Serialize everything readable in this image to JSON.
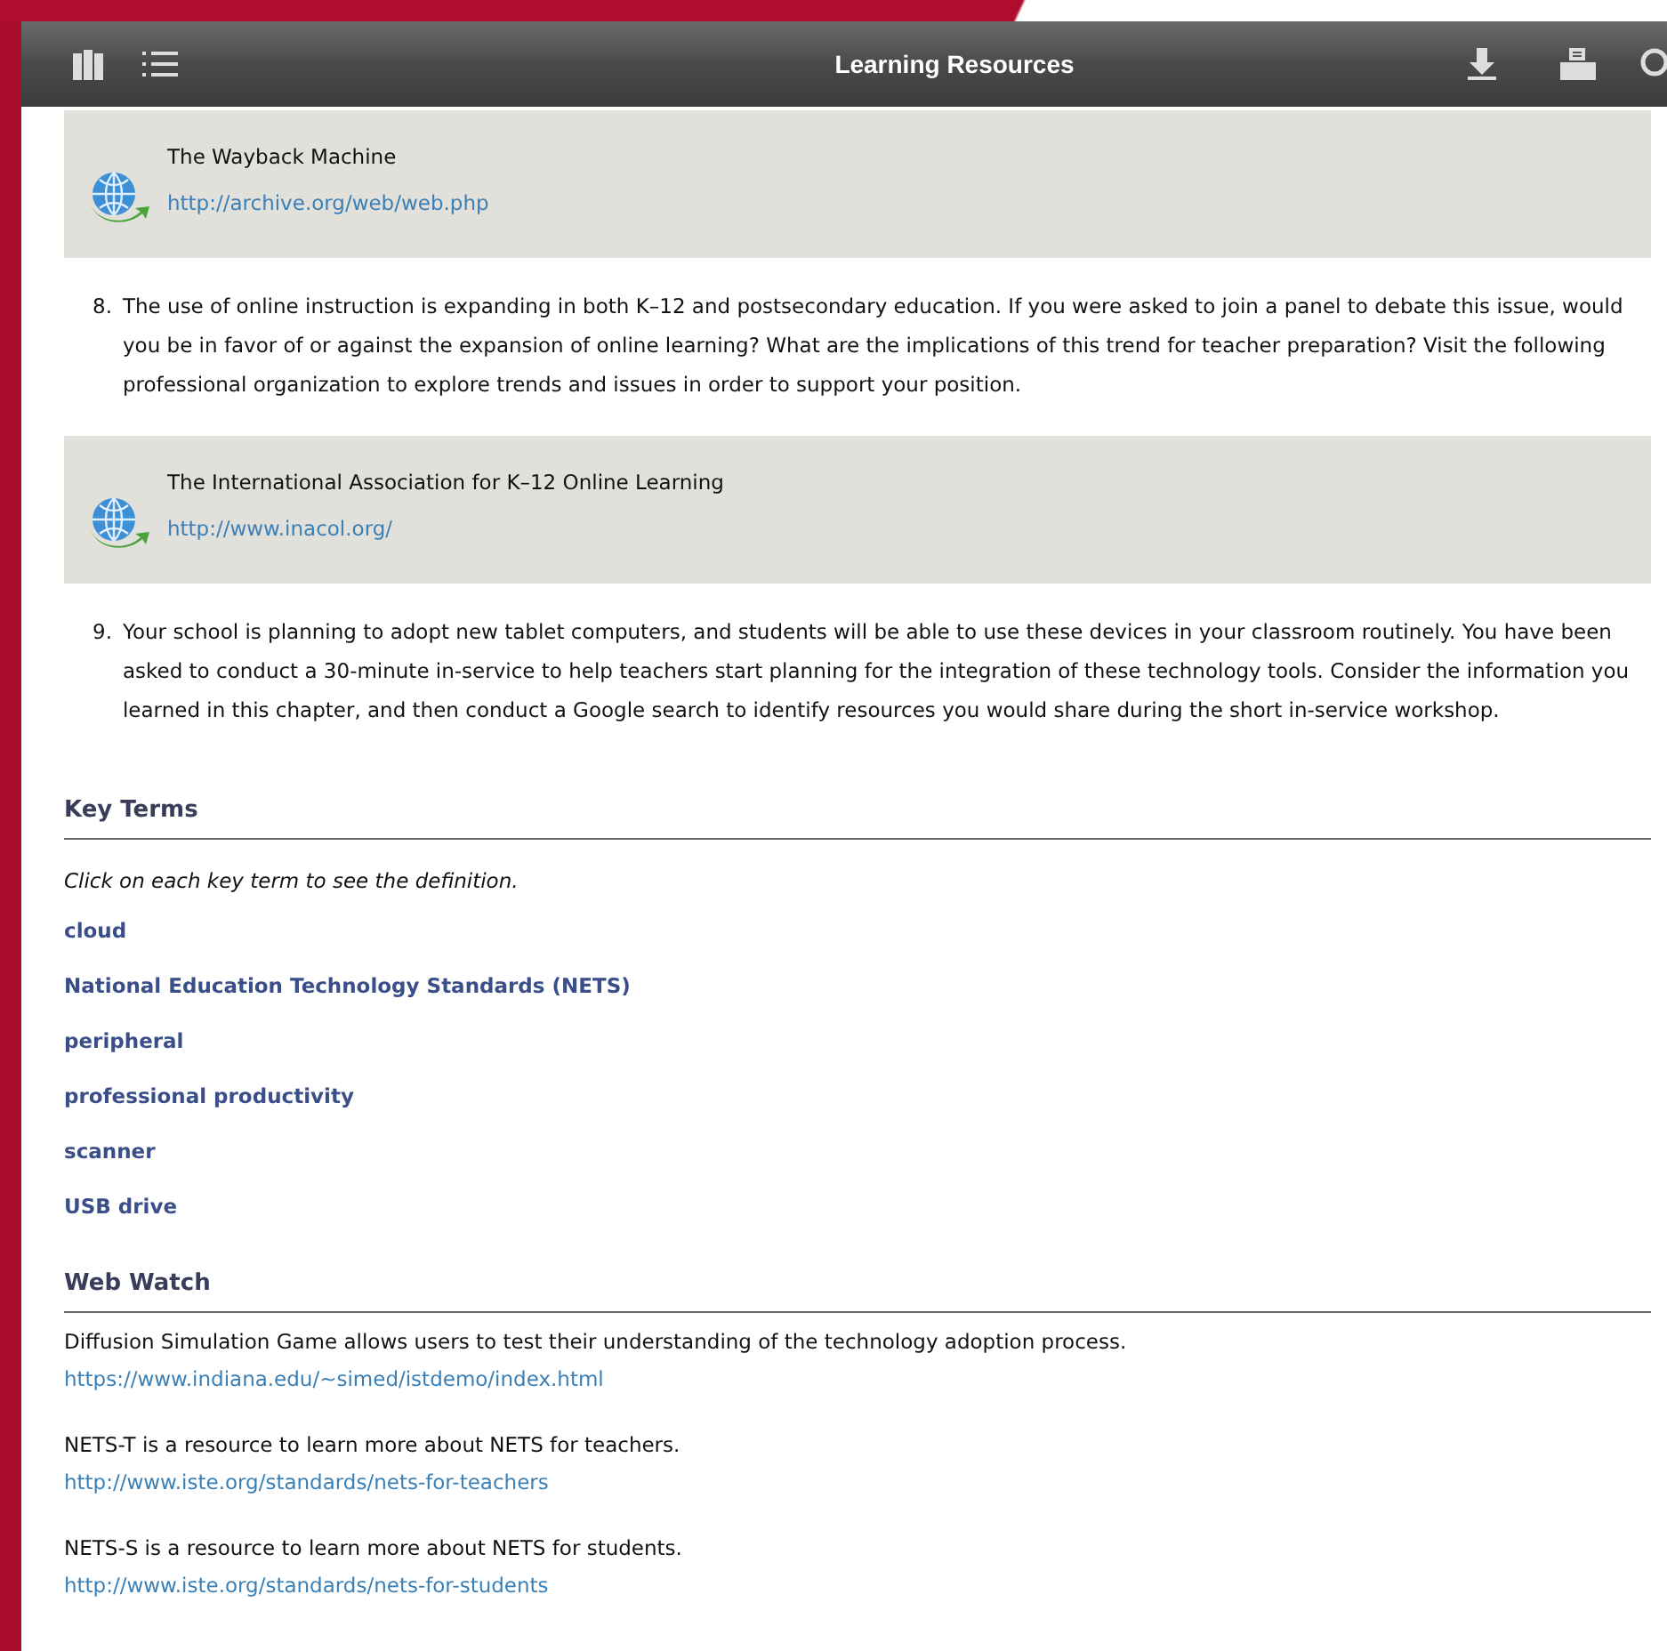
{
  "toolbar": {
    "title": "Learning Resources"
  },
  "items": [
    {
      "kind": "resource",
      "name": "The Wayback Machine",
      "url": "http://archive.org/web/web.php"
    },
    {
      "kind": "question",
      "number": "8.",
      "text": "The use of online instruction is expanding in both K–12 and postsecondary education. If you were asked to join a panel to debate this issue, would you be in favor of or against the expansion of online learning? What are the implications of this trend for teacher preparation? Visit the following professional organization to explore trends and issues in order to support your position."
    },
    {
      "kind": "resource",
      "name": "The International Association for K–12 Online Learning",
      "url": "http://www.inacol.org/"
    },
    {
      "kind": "question",
      "number": "9.",
      "text": "Your school is planning to adopt new tablet computers, and students will be able to use these devices in your classroom routinely. You have been asked to conduct a 30-minute in-service to help teachers start planning for the integration of these technology tools. Consider the information you learned in this chapter, and then conduct a Google search to identify resources you would share during the short in-service workshop."
    }
  ],
  "key_terms": {
    "heading": "Key Terms",
    "instruction": "Click on each key term to see the definition.",
    "terms": [
      "cloud",
      "National Education Technology Standards (NETS)",
      "peripheral",
      "professional productivity",
      "scanner",
      "USB drive"
    ]
  },
  "web_watch": {
    "heading": "Web Watch",
    "entries": [
      {
        "description": "Diffusion Simulation Game allows users to test their understanding of the technology adoption process.",
        "url": "https://www.indiana.edu/~simed/istdemo/index.html"
      },
      {
        "description": "NETS-T is a resource to learn more about NETS for teachers.",
        "url": "http://www.iste.org/standards/nets-for-teachers"
      },
      {
        "description": "NETS-S is a resource to learn more about NETS for students.",
        "url": "http://www.iste.org/standards/nets-for-students"
      }
    ]
  }
}
